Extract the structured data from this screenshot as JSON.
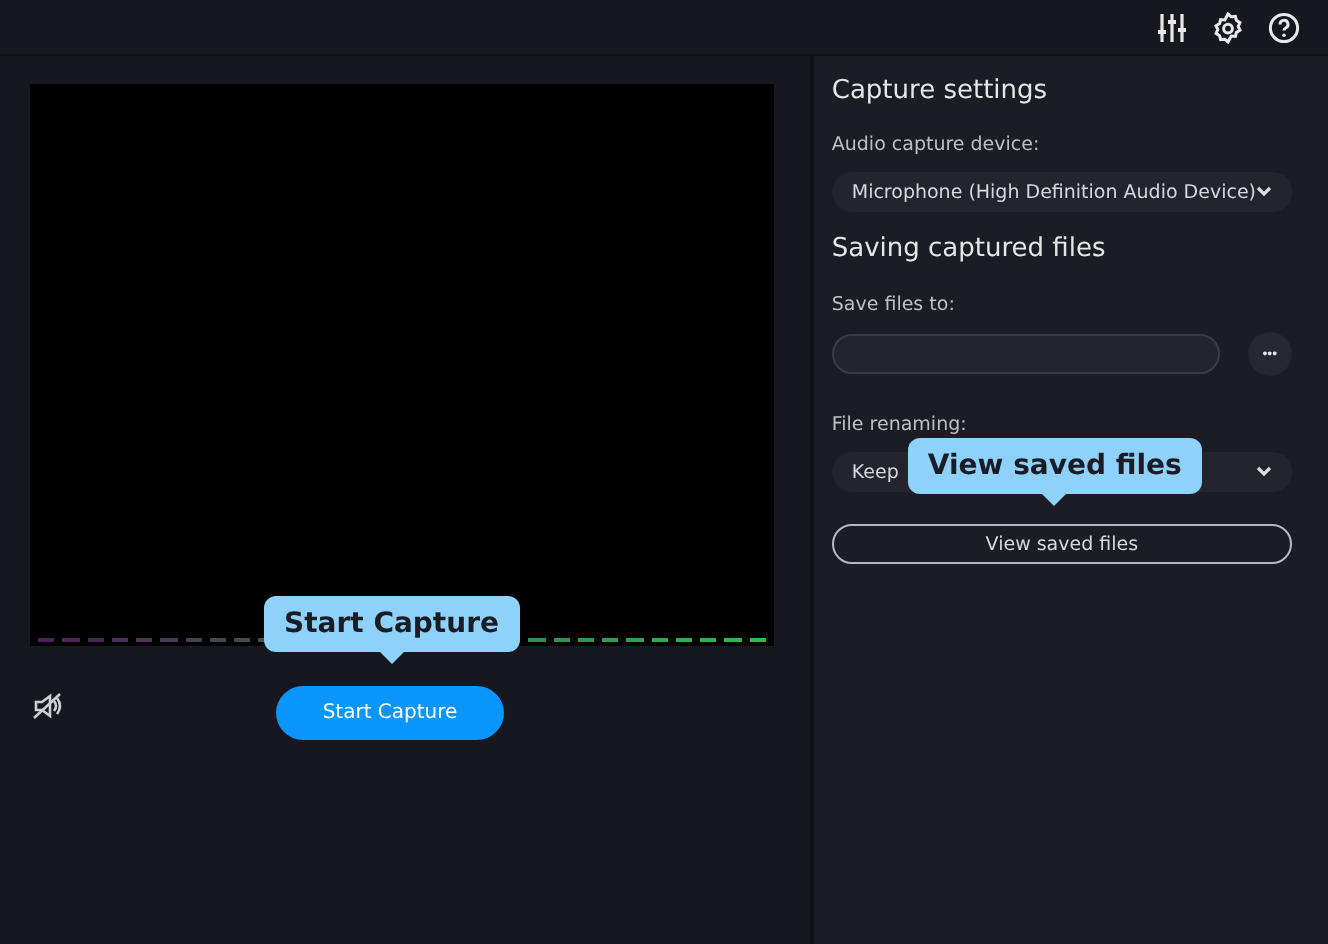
{
  "preview": {
    "start_button": "Start Capture",
    "tooltip": "Start Capture"
  },
  "settings": {
    "title": "Capture settings",
    "audio_label": "Audio capture device:",
    "audio_device": "Microphone (High Definition Audio Device)",
    "saving_title": "Saving captured files",
    "save_label": "Save files to:",
    "save_path_button": "•••",
    "renaming_label": "File renaming:",
    "renaming_value": "Keep",
    "view_button": "View saved files",
    "tooltip": "View saved files"
  }
}
